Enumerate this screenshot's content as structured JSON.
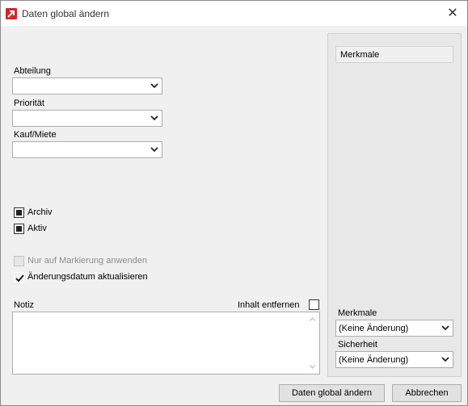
{
  "window": {
    "title": "Daten global ändern",
    "close_glyph": "✕"
  },
  "form": {
    "abteilung": {
      "label": "Abteilung",
      "value": ""
    },
    "prioritaet": {
      "label": "Priorität",
      "value": ""
    },
    "kauf_miete": {
      "label": "Kauf/Miete",
      "value": ""
    }
  },
  "checkboxes": {
    "archiv": {
      "label": "Archiv",
      "state": "indeterminate"
    },
    "aktiv": {
      "label": "Aktiv",
      "state": "indeterminate"
    },
    "nur_markierung": {
      "label": "Nur auf Markierung anwenden",
      "state": "disabled"
    },
    "aenderungsdatum": {
      "label": "Änderungsdatum aktualisieren",
      "state": "checked"
    }
  },
  "notiz": {
    "label": "Notiz",
    "remove_label": "Inhalt entfernen",
    "value": ""
  },
  "side_panel": {
    "header": "Merkmale",
    "merkmale": {
      "label": "Merkmale",
      "value": "(Keine Änderung)"
    },
    "sicherheit": {
      "label": "Sicherheit",
      "value": "(Keine Änderung)"
    }
  },
  "buttons": {
    "apply": "Daten global ändern",
    "cancel": "Abbrechen"
  },
  "colors": {
    "accent_red": "#d6262c",
    "background": "#f0f0f0",
    "panel": "#e8e8e8"
  }
}
